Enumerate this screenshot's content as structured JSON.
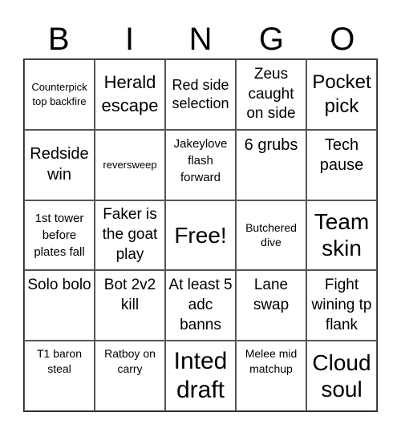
{
  "title": {
    "letters": [
      "B",
      "I",
      "N",
      "G",
      "O"
    ]
  },
  "grid": {
    "rows": [
      [
        {
          "text": "Counterpick top backfire",
          "size": "s13"
        },
        {
          "text": "Herald escape",
          "size": "s22"
        },
        {
          "text": "Red side selection",
          "size": "s18"
        },
        {
          "text": "Zeus caught on side",
          "size": "s19"
        },
        {
          "text": "Pocket pick",
          "size": "s24"
        }
      ],
      [
        {
          "text": "Redside win",
          "size": "s20"
        },
        {
          "text": "reversweep",
          "size": "s13"
        },
        {
          "text": "Jakeylove flash forward",
          "size": "s15",
          "top": true
        },
        {
          "text": "6 grubs",
          "size": "s20",
          "top": true
        },
        {
          "text": "Tech pause",
          "size": "s20",
          "top": true
        }
      ],
      [
        {
          "text": "1st tower before plates fall",
          "size": "s15"
        },
        {
          "text": "Faker is the goat play",
          "size": "s19"
        },
        {
          "text": "Free!",
          "size": "s28"
        },
        {
          "text": "Butchered dive",
          "size": "s14"
        },
        {
          "text": "Team skin",
          "size": "s28"
        }
      ],
      [
        {
          "text": "Solo bolo",
          "size": "s19",
          "top": true
        },
        {
          "text": "Bot 2v2 kill",
          "size": "s19",
          "top": true
        },
        {
          "text": "At least 5 adc banns",
          "size": "s19",
          "top": true
        },
        {
          "text": "Lane swap",
          "size": "s19",
          "top": true
        },
        {
          "text": "Fight wining tp flank",
          "size": "s19",
          "top": true
        }
      ],
      [
        {
          "text": "T1 baron steal",
          "size": "s14",
          "top": true
        },
        {
          "text": "Ratboy on carry",
          "size": "s14",
          "top": true
        },
        {
          "text": "Inted draft",
          "size": "s30"
        },
        {
          "text": "Melee mid matchup",
          "size": "s14",
          "top": true
        },
        {
          "text": "Cloud soul",
          "size": "s28"
        }
      ]
    ]
  }
}
